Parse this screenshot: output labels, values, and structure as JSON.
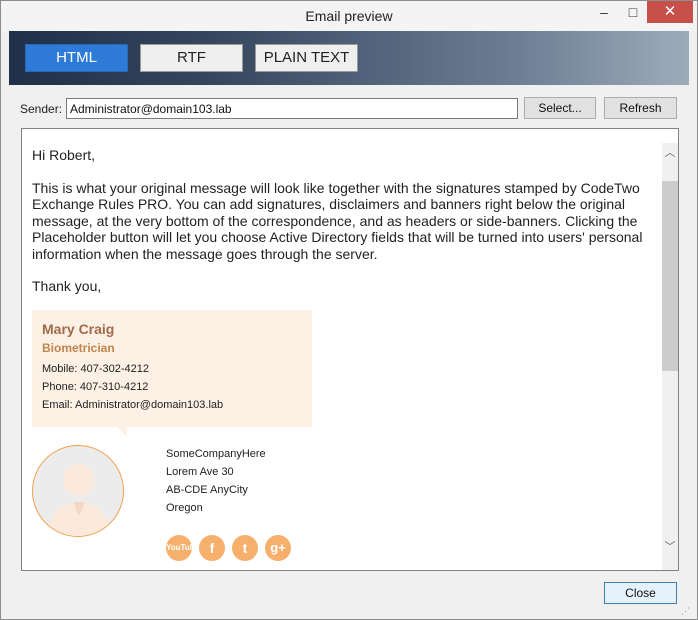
{
  "window": {
    "title": "Email preview",
    "minimize": "–",
    "maximize": "□",
    "close": "✕"
  },
  "modes": [
    "HTML",
    "RTF",
    "PLAIN TEXT"
  ],
  "sender": {
    "label": "Sender:",
    "value": "Administrator@domain103.lab",
    "select_button": "Select...",
    "refresh_button": "Refresh"
  },
  "message": {
    "greeting": "Hi Robert,",
    "body": "This is what your original message will look like together with the signatures stamped by CodeTwo Exchange Rules PRO. You can add signatures, disclaimers and banners right below the original message, at the very bottom of the correspondence, and as headers or side-banners. Clicking the Placeholder button will let you choose Active Directory fields that will be turned into users' personal information when the message goes through the server.",
    "closing": "Thank you,"
  },
  "signature": {
    "name": "Mary Craig",
    "job": "Biometrician",
    "mobile": "Mobile: 407-302-4212",
    "phone": "Phone: 407-310-4212",
    "email": "Email: Administrator@domain103.lab",
    "company": "SomeCompanyHere",
    "street": "Lorem Ave 30",
    "city": "AB-CDE AnyCity",
    "state": "Oregon",
    "social": {
      "youtube": "YouTube",
      "facebook": "f",
      "twitter": "t",
      "googleplus": "g+"
    }
  },
  "footer": {
    "close_button": "Close"
  },
  "colors": {
    "accent": "#2d7bd6",
    "signature_bg": "#fdf1e5",
    "social": "#f6b06b",
    "name": "#a06a4a"
  }
}
